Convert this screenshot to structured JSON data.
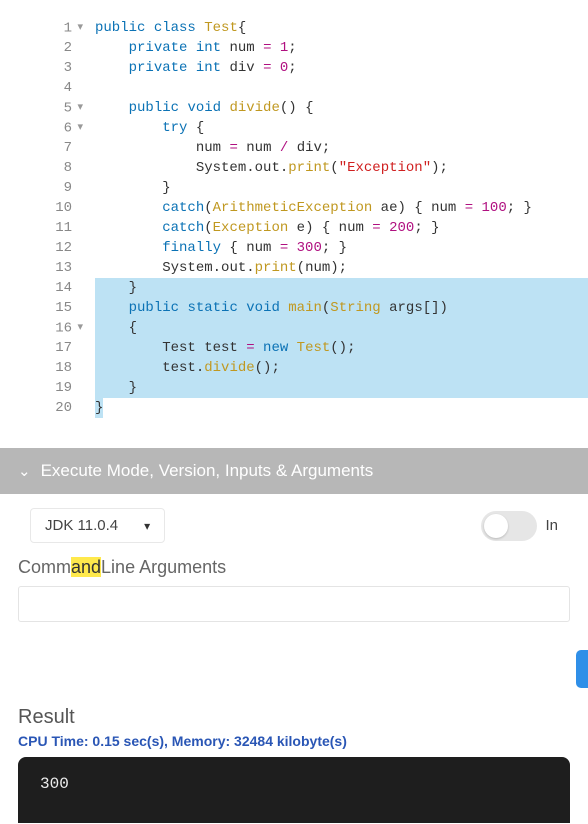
{
  "editor": {
    "lines": [
      {
        "n": "1",
        "fold": true
      },
      {
        "n": "2",
        "fold": false
      },
      {
        "n": "3",
        "fold": false
      },
      {
        "n": "4",
        "fold": false
      },
      {
        "n": "5",
        "fold": true
      },
      {
        "n": "6",
        "fold": true
      },
      {
        "n": "7",
        "fold": false
      },
      {
        "n": "8",
        "fold": false
      },
      {
        "n": "9",
        "fold": false
      },
      {
        "n": "10",
        "fold": false
      },
      {
        "n": "11",
        "fold": false
      },
      {
        "n": "12",
        "fold": false
      },
      {
        "n": "13",
        "fold": false
      },
      {
        "n": "14",
        "fold": false
      },
      {
        "n": "15",
        "fold": false
      },
      {
        "n": "16",
        "fold": true
      },
      {
        "n": "17",
        "fold": false
      },
      {
        "n": "18",
        "fold": false
      },
      {
        "n": "19",
        "fold": false
      },
      {
        "n": "20",
        "fold": false
      }
    ],
    "tokens": {
      "l1": {
        "a": "public",
        "b": "class",
        "c": "Test",
        "d": "{"
      },
      "l2": {
        "a": "private",
        "b": "int",
        "c": "num",
        "d": "=",
        "e": "1",
        "f": ";"
      },
      "l3": {
        "a": "private",
        "b": "int",
        "c": "div",
        "d": "=",
        "e": "0",
        "f": ";"
      },
      "l5": {
        "a": "public",
        "b": "void",
        "c": "divide",
        "d": "() {"
      },
      "l6": {
        "a": "try",
        "b": "{"
      },
      "l7": {
        "a": "num",
        "b": "=",
        "c": "num",
        "d": "/",
        "e": "div",
        "f": ";"
      },
      "l8": {
        "a": "System",
        "b": ".out.",
        "c": "print",
        "d": "(",
        "e": "\"Exception\"",
        "f": ");"
      },
      "l9": {
        "a": "}"
      },
      "l10": {
        "a": "catch",
        "b": "(",
        "c": "ArithmeticException",
        "d": " ae) { num ",
        "e": "=",
        "f": "100",
        "g": "; }"
      },
      "l11": {
        "a": "catch",
        "b": "(",
        "c": "Exception",
        "d": " e) { num ",
        "e": "=",
        "f": "200",
        "g": "; }"
      },
      "l12": {
        "a": "finally",
        "b": " { num ",
        "c": "=",
        "d": "300",
        "e": "; }"
      },
      "l13": {
        "a": "System",
        "b": ".out.",
        "c": "print",
        "d": "(num);"
      },
      "l14": {
        "a": "}"
      },
      "l15": {
        "a": "public",
        "b": "static",
        "c": "void",
        "d": "main",
        "e": "(",
        "f": "String",
        "g": " args[])"
      },
      "l16": {
        "a": "{"
      },
      "l17": {
        "a": "Test test ",
        "b": "=",
        "c": "new",
        "d": "Test",
        "e": "();"
      },
      "l18": {
        "a": "test.",
        "b": "divide",
        "c": "();"
      },
      "l19": {
        "a": "}"
      },
      "l20": {
        "a": "}"
      }
    }
  },
  "exec": {
    "header": "Execute Mode, Version, Inputs & Arguments",
    "jdk_version": "JDK 11.0.4",
    "toggle_label": "In",
    "commandline_pre": "Comm",
    "commandline_hl": "and",
    "commandline_post": "Line Arguments"
  },
  "result": {
    "label": "Result",
    "cpu": "CPU Time: 0.15 sec(s), Memory: 32484 kilobyte(s)",
    "output": "300"
  }
}
